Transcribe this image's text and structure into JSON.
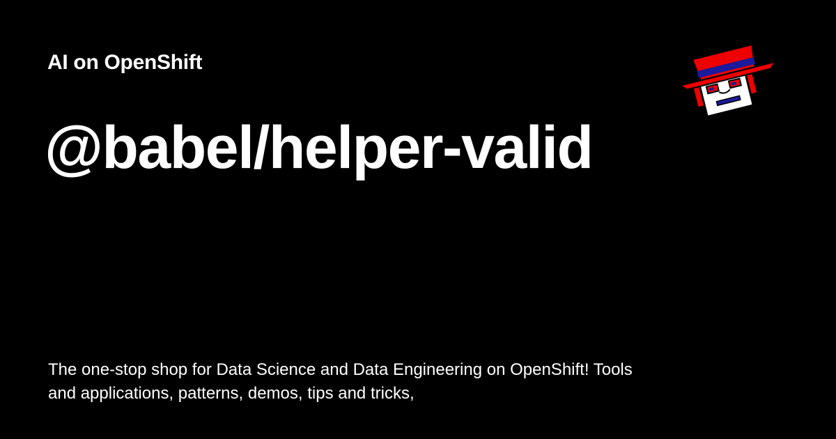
{
  "header": {
    "site_name": "AI on OpenShift"
  },
  "main": {
    "title": "@babel/helper-valid",
    "description": "The one-stop shop for Data Science and Data Engineering on OpenShift! Tools and applications, patterns, demos, tips and tricks,"
  },
  "logo": {
    "icon": "robot-with-red-hat-icon"
  },
  "colors": {
    "background": "#000000",
    "text": "#ffffff",
    "hat_red": "#ee0000",
    "hat_band_blue": "#1a1a9c"
  }
}
